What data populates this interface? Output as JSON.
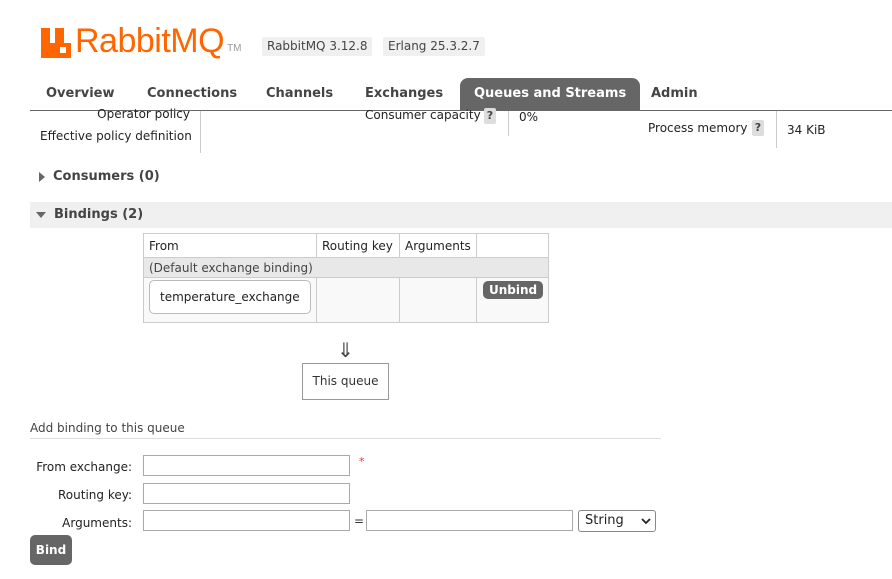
{
  "header": {
    "logo_rabbit": "Rabbit",
    "logo_mq": "MQ",
    "logo_tm": "TM",
    "rabbitmq_version": "RabbitMQ 3.12.8",
    "erlang_version": "Erlang 25.3.2.7",
    "brand_color": "#ff6600"
  },
  "tabs": [
    {
      "label": "Overview"
    },
    {
      "label": "Connections"
    },
    {
      "label": "Channels"
    },
    {
      "label": "Exchanges"
    },
    {
      "label": "Queues and Streams",
      "active": true
    },
    {
      "label": "Admin"
    }
  ],
  "details": {
    "operator_policy_label": "Operator policy",
    "effective_policy_label": "Effective policy definition",
    "consumer_capacity_label": "Consumer capacity",
    "consumer_capacity_value": "0%",
    "process_memory_label": "Process memory",
    "process_memory_value": "34 KiB",
    "help_glyph": "?"
  },
  "consumers": {
    "title": "Consumers (0)"
  },
  "bindings": {
    "title": "Bindings (2)",
    "columns": [
      "From",
      "Routing key",
      "Arguments",
      ""
    ],
    "default_binding_text": "(Default exchange binding)",
    "rows": [
      {
        "from": "temperature_exchange",
        "routing_key": "",
        "arguments": "",
        "action": "Unbind"
      }
    ],
    "arrow_glyph": "⇓",
    "this_queue": "This queue"
  },
  "add_binding": {
    "title": "Add binding to this queue",
    "from_exchange_label": "From exchange:",
    "from_exchange_value": "",
    "required_mark": "*",
    "routing_key_label": "Routing key:",
    "routing_key_value": "",
    "arguments_label": "Arguments:",
    "argument_key_value": "",
    "equals": "=",
    "argument_value_value": "",
    "type_selected": "String",
    "bind_label": "Bind"
  }
}
